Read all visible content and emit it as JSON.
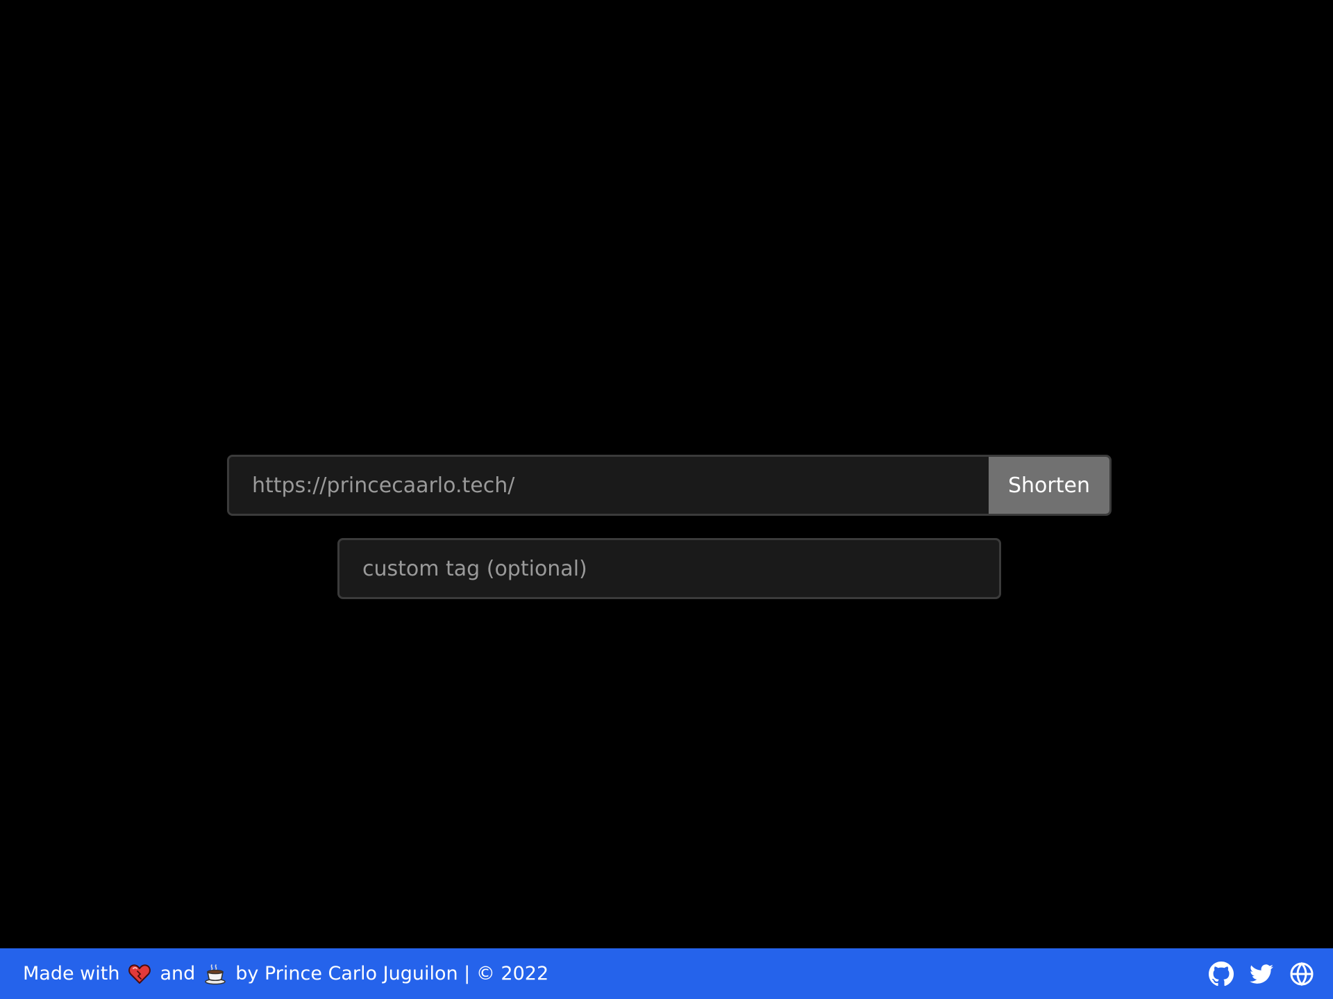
{
  "form": {
    "url_placeholder": "https://princecaarlo.tech/",
    "shorten_label": "Shorten",
    "tag_placeholder": "custom tag (optional)"
  },
  "footer": {
    "made_with": "Made with",
    "heart_icon": "heart-icon",
    "and": "and",
    "coffee_icon": "coffee-icon",
    "byline": "by Prince Carlo Juguilon | © 2022",
    "social_icons": [
      "github-icon",
      "twitter-icon",
      "globe-icon"
    ]
  },
  "colors": {
    "background": "#000000",
    "input_background": "#1a1a1a",
    "input_border": "#3b3b3b",
    "button_background": "#717171",
    "footer_background": "#2563eb",
    "footer_text": "#ffffff"
  }
}
